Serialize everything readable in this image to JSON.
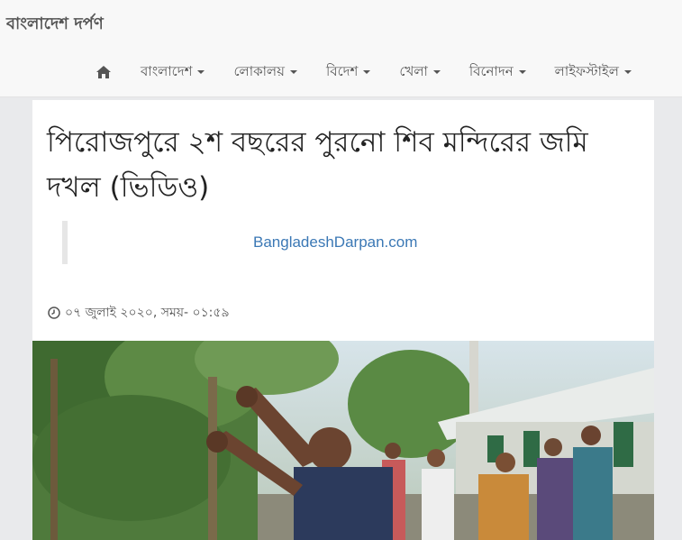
{
  "site": {
    "name": "বাংলাদেশ দর্পণ"
  },
  "nav": {
    "home_icon": "home-icon",
    "items": [
      {
        "label": "বাংলাদেশ"
      },
      {
        "label": "লোকালয়"
      },
      {
        "label": "বিদেশ"
      },
      {
        "label": "খেলা"
      },
      {
        "label": "বিনোদন"
      },
      {
        "label": "লাইফস্টাইল"
      }
    ]
  },
  "article": {
    "title": "পিরোজপুরে ২শ বছরের পুরনো শিব মন্দিরের জমি দখল (ভিডিও)",
    "source": "BangladeshDarpan.com",
    "datetime": "০৭ জুলাই ২০২০, সময়- ০১:৫৯",
    "clock_icon": "clock-icon",
    "image_alt": "photo"
  },
  "colors": {
    "topbar_bg": "#f8f8f8",
    "page_bg": "#e9eaec",
    "link": "#3b78b5",
    "nav_text": "#555555"
  }
}
